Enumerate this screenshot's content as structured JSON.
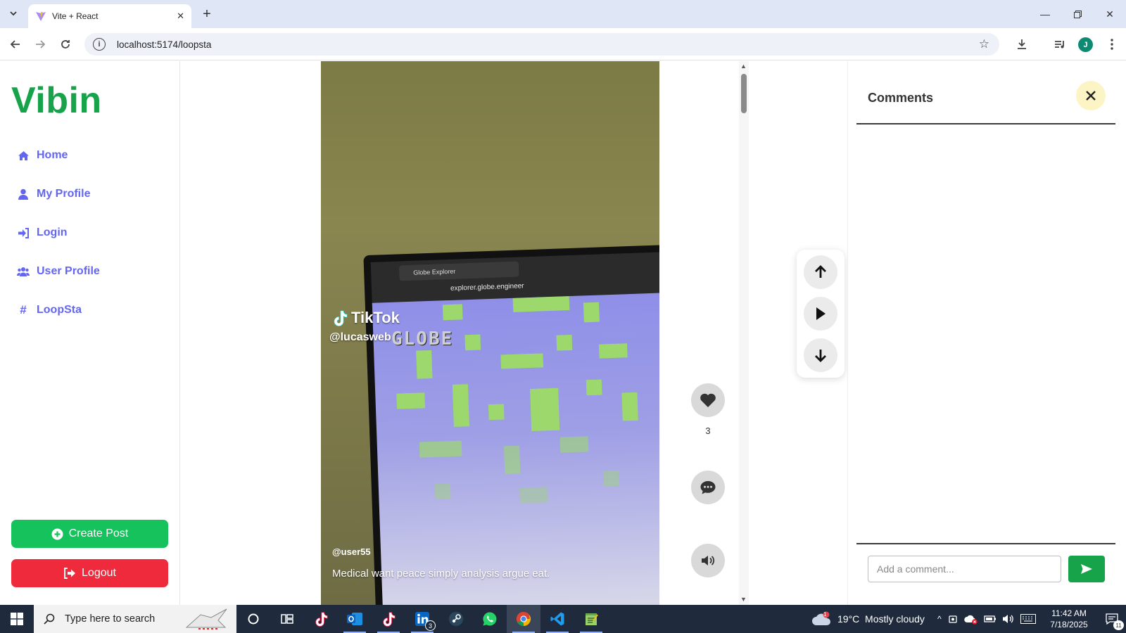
{
  "browser": {
    "tab_title": "Vite + React",
    "url": "localhost:5174/loopsta",
    "avatar_letter": "J"
  },
  "app": {
    "logo": "Vibin",
    "nav": [
      {
        "label": "Home",
        "icon": "home-icon"
      },
      {
        "label": "My Profile",
        "icon": "user-icon"
      },
      {
        "label": "Login",
        "icon": "login-icon"
      },
      {
        "label": "User Profile",
        "icon": "users-icon"
      },
      {
        "label": "LoopSta",
        "icon": "hashtag-icon"
      }
    ],
    "create_post": "Create Post",
    "logout": "Logout",
    "accent": "#6366f1",
    "brand_green": "#16a34a",
    "danger_red": "#ee2a3c"
  },
  "video": {
    "watermark_brand": "TikTok",
    "watermark_handle": "@lucasweb",
    "screen_tab": "Globe Explorer",
    "screen_url": "explorer.globe.engineer",
    "screen_text": "GLOBE",
    "post_user": "@user55",
    "post_caption": "Medical want peace simply analysis argue eat.",
    "like_count": "3"
  },
  "comments": {
    "title": "Comments",
    "placeholder": "Add a comment..."
  },
  "taskbar": {
    "search_placeholder": "Type here to search",
    "weather": "19°C  Mostly cloudy",
    "time": "11:42 AM",
    "date": "7/18/2025",
    "linkedin_badge": "3",
    "weather_badge": "1",
    "notif_count": "11"
  }
}
